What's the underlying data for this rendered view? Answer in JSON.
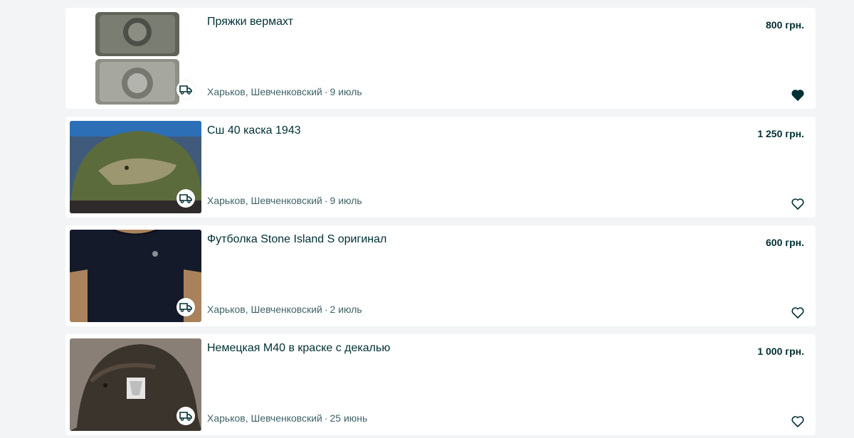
{
  "listings": [
    {
      "title": "Пряжки вермахт",
      "price": "800 грн.",
      "location": "Харьков, Шевченковский",
      "separator": "·",
      "date": "9 июль",
      "favorited": true,
      "thumb": "belt-buckles-icon"
    },
    {
      "title": "Сш 40 каска 1943",
      "price": "1 250 грн.",
      "location": "Харьков, Шевченковский",
      "separator": "·",
      "date": "9 июль",
      "favorited": false,
      "thumb": "green-helmet-icon"
    },
    {
      "title": "Футболка Stone Island S оригинал",
      "price": "600 грн.",
      "location": "Харьков, Шевченковский",
      "separator": "·",
      "date": "2 июль",
      "favorited": false,
      "thumb": "tshirt-icon"
    },
    {
      "title": "Немецкая М40 в краске с декалью",
      "price": "1 000 грн.",
      "location": "Харьков, Шевченковский",
      "separator": "·",
      "date": "25 июнь",
      "favorited": false,
      "thumb": "rusted-helmet-icon"
    }
  ],
  "colors": {
    "text": "#002f34",
    "muted": "#406367",
    "background": "#f2f4f5",
    "card": "#ffffff"
  }
}
